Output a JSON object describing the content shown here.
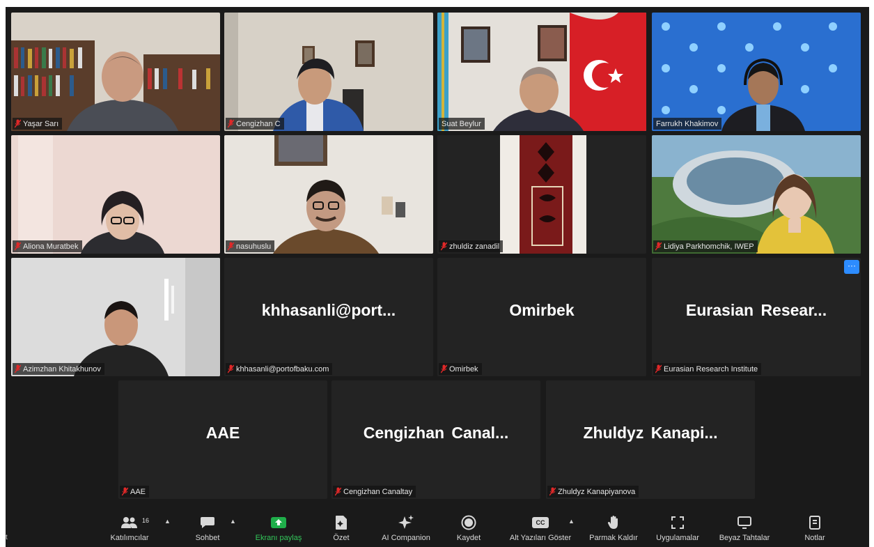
{
  "participants": {
    "yasar": "Yaşar Sarı",
    "cengizhan_c": "Cengizhan C",
    "suat": "Suat Beylur",
    "farrukh": "Farrukh Khakimov",
    "aliona": "Aliona Muratbek",
    "nasuhuslu": "nasuhuslu",
    "zhuldiz": "zhuldiz zanadil",
    "lidiya": "Lidiya Parkhomchik, IWEP",
    "azimzhan": "Azimzhan Khitakhunov",
    "khhasanli_center": "khhasanli@port...",
    "khhasanli_tag": "khhasanli@portofbaku.com",
    "omirbek_center": "Omirbek",
    "omirbek_tag": "Omirbek",
    "eurasian_center": "Eurasian Resear...",
    "eurasian_tag": "Eurasian Research Institute",
    "aae_center": "AAE",
    "aae_tag": "AAE",
    "canaltay_center": "Cengizhan Canal...",
    "canaltay_tag": "Cengizhan Canaltay",
    "kanapi_center": "Zhuldyz Kanapi...",
    "kanapi_tag": "Zhuldyz Kanapiyanova"
  },
  "more_button": "···",
  "toolbar": {
    "participants_count": "16",
    "participants": "Katılımcılar",
    "chat": "Sohbet",
    "share": "Ekranı paylaş",
    "summary": "Özet",
    "ai": "AI Companion",
    "record": "Kaydet",
    "captions": "Alt Yazıları Göster",
    "raise_hand": "Parmak Kaldır",
    "apps": "Uygulamalar",
    "whiteboards": "Beyaz Tahtalar",
    "notes": "Notlar",
    "edge_text": "t",
    "cc_badge": "CC"
  },
  "colors": {
    "speaking_border": "#d6e05a",
    "share_green": "#33c75a",
    "mute_red": "#e02828",
    "accent_blue": "#2d8cff"
  }
}
